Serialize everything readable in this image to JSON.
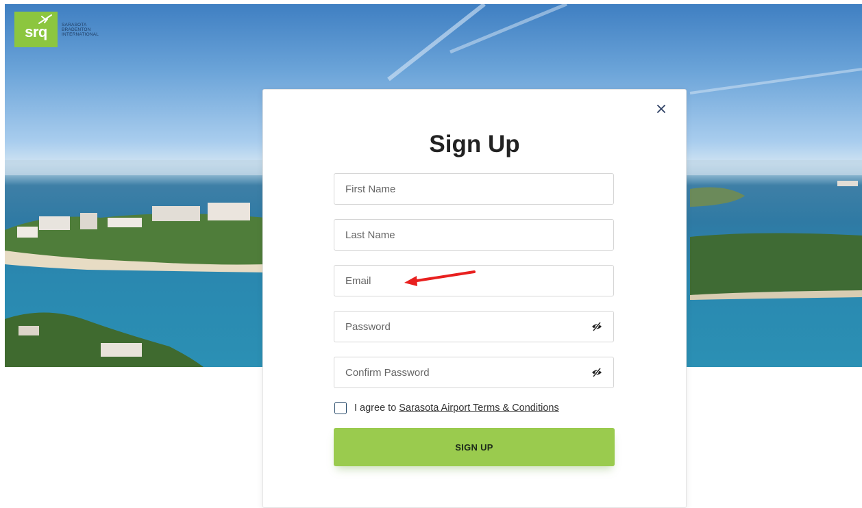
{
  "brand": {
    "logo_mark": "srq",
    "logo_lines": [
      "SARASOTA",
      "BRADENTON",
      "INTERNATIONAL"
    ],
    "accent_color": "#8cc63f"
  },
  "modal": {
    "title": "Sign Up",
    "close_icon": "close-icon",
    "fields": {
      "first_name": {
        "placeholder": "First Name",
        "value": ""
      },
      "last_name": {
        "placeholder": "Last Name",
        "value": ""
      },
      "email": {
        "placeholder": "Email",
        "value": ""
      },
      "password": {
        "placeholder": "Password",
        "value": "",
        "icon": "eye-slash-icon"
      },
      "confirm_password": {
        "placeholder": "Confirm Password",
        "value": "",
        "icon": "eye-slash-icon"
      }
    },
    "agree_prefix": "I agree to",
    "terms_link": "Sarasota Airport Terms & Conditions",
    "terms_checked": false,
    "submit_label": "SIGN UP",
    "submit_color": "#9acb4e"
  },
  "annotation": {
    "arrow_color": "#e8201f"
  }
}
